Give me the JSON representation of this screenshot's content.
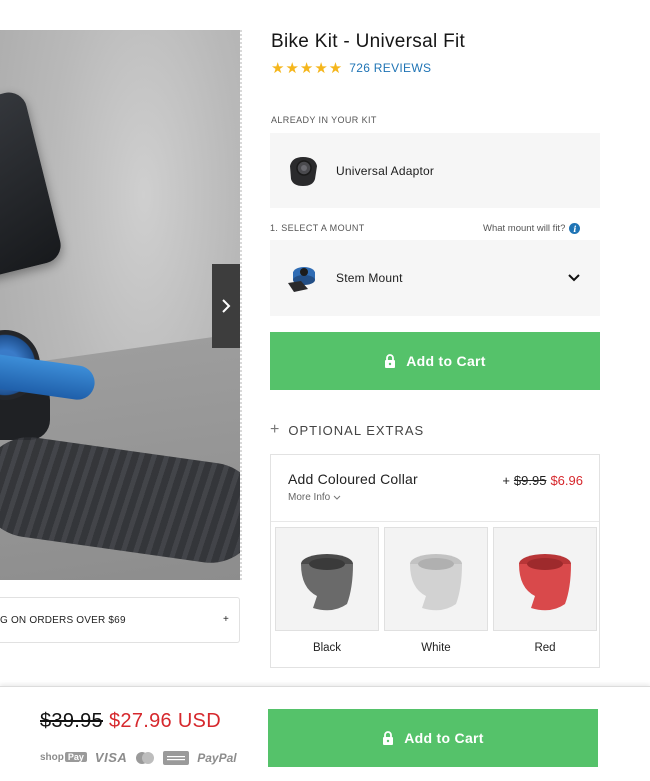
{
  "product": {
    "title": "Bike Kit - Universal Fit",
    "rating_stars": "★★★★★",
    "reviews_label": "726 REVIEWS"
  },
  "promo": {
    "text": "G ON ORDERS OVER $69",
    "plus": "+"
  },
  "kit": {
    "label": "ALREADY IN YOUR KIT",
    "item_name": "Universal Adaptor"
  },
  "mount": {
    "label": "1. SELECT A MOUNT",
    "help_link": "What mount will fit?",
    "help_icon": "i",
    "selected": "Stem Mount"
  },
  "cart": {
    "label": "Add to Cart"
  },
  "extras": {
    "heading": "OPTIONAL EXTRAS",
    "sign": "+",
    "collar": {
      "title": "Add Coloured Collar",
      "more_info": "More Info",
      "price_prefix": "+",
      "price_old": "$9.95",
      "price_new": "$6.96",
      "options": [
        {
          "label": "Black",
          "color": "#6a6a6a"
        },
        {
          "label": "White",
          "color": "#d2d2d2"
        },
        {
          "label": "Red",
          "color": "#d9494b"
        }
      ]
    }
  },
  "sticky": {
    "price_old": "$39.95",
    "price_new": "$27.96 USD",
    "cart_label": "Add to Cart",
    "payments": {
      "shop": "shop",
      "pay": "Pay",
      "visa": "VISA",
      "paypal": "PayPal"
    }
  },
  "colors": {
    "accent_green": "#55c26a",
    "sale_red": "#d6282d",
    "link_blue": "#1f74b5",
    "star": "#f5b61c"
  }
}
